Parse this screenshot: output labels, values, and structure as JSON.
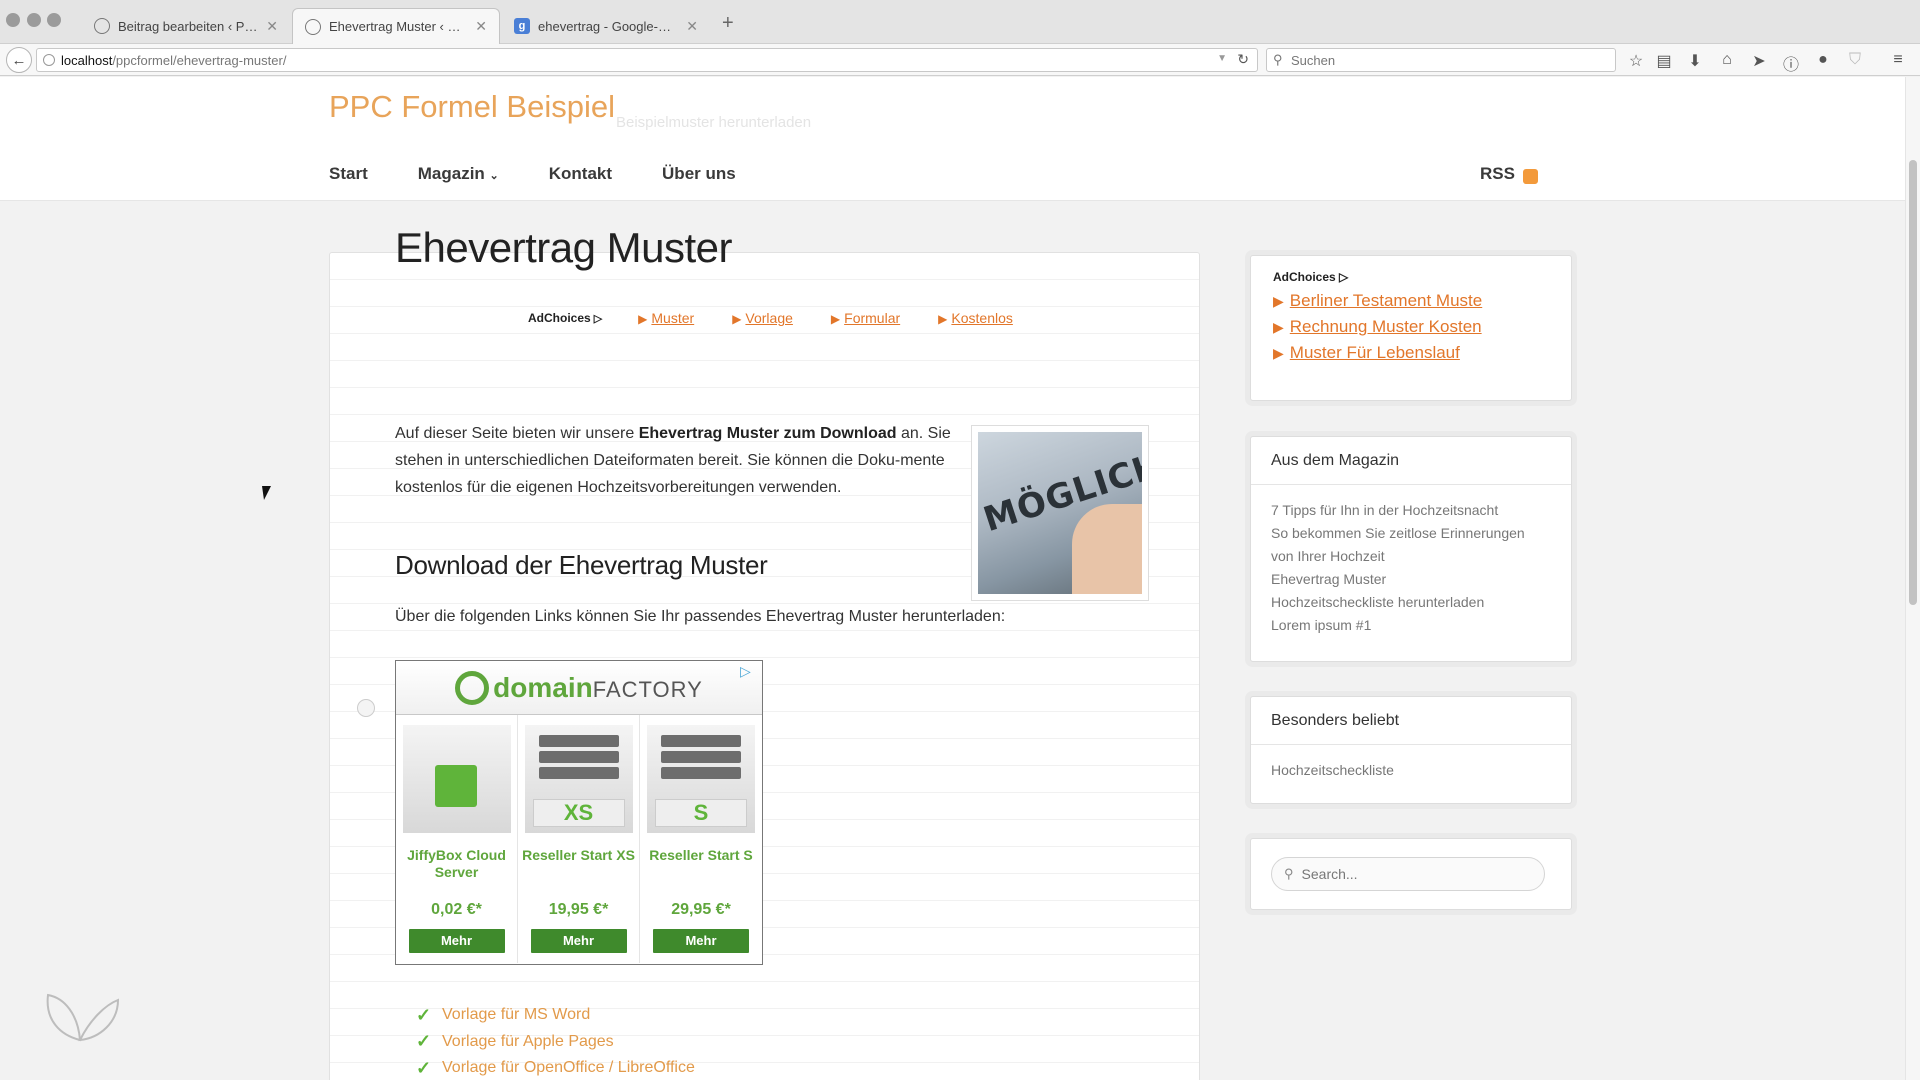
{
  "browser": {
    "tabs": [
      {
        "label": "Beitrag bearbeiten ‹ PPC Fo...",
        "active": false
      },
      {
        "label": "Ehevertrag Muster ‹ PPC Fo...",
        "active": true
      },
      {
        "label": "ehevertrag - Google-Suche",
        "active": false
      }
    ],
    "url_host": "localhost",
    "url_path": "/ppcformel/ehevertrag-muster/",
    "search_placeholder": "Suchen"
  },
  "site": {
    "title": "PPC Formel Beispiel",
    "tagline": "Beispielmuster herunterladen",
    "nav": [
      "Start",
      "Magazin",
      "Kontakt",
      "Über uns"
    ],
    "rss_label": "RSS"
  },
  "article": {
    "title": "Ehevertrag Muster",
    "adchoices_label": "AdChoices",
    "ad_links": [
      "Muster",
      "Vorlage",
      "Formular",
      "Kostenlos"
    ],
    "intro_1": "Auf dieser Seite bieten wir unsere ",
    "intro_bold": "Ehevertrag Muster zum Download",
    "intro_2": " an. Sie stehen in unterschiedlichen Dateiformaten bereit. Sie können die Doku-mente kostenlos für die eigenen Hochzeitsvorbereitungen verwenden.",
    "photo_word": "MÖGLICH!",
    "download_heading": "Download der Ehevertrag Muster",
    "download_text": "Über die folgenden Links können Sie Ihr passendes Ehevertrag Muster herunterladen:",
    "banner": {
      "brand_main": "domain",
      "brand_sub": "FACTORY",
      "products": [
        {
          "name": "JiffyBox Cloud Server",
          "price": "0,02 €*",
          "button": "Mehr",
          "badge": ""
        },
        {
          "name": "Reseller Start XS",
          "price": "19,95 €*",
          "button": "Mehr",
          "badge": "XS"
        },
        {
          "name": "Reseller Start S",
          "price": "29,95 €*",
          "button": "Mehr",
          "badge": "S"
        }
      ]
    },
    "downloads": [
      "Vorlage für MS Word",
      "Vorlage für Apple Pages",
      "Vorlage für OpenOffice / LibreOffice"
    ]
  },
  "sidebar": {
    "ad": {
      "adchoices_label": "AdChoices",
      "links": [
        "Berliner Testament Muste",
        "Rechnung Muster Kosten",
        "Muster Für Lebenslauf"
      ]
    },
    "magazin": {
      "title": "Aus dem Magazin",
      "items": [
        "7 Tipps für Ihn in der Hochzeitsnacht",
        "So bekommen Sie zeitlose Erinnerungen von Ihrer Hochzeit",
        "Ehevertrag Muster",
        "Hochzeitscheckliste herunterladen",
        "Lorem ipsum #1"
      ]
    },
    "popular": {
      "title": "Besonders beliebt",
      "items": [
        "Hochzeitscheckliste"
      ]
    },
    "search_placeholder": "Search..."
  }
}
